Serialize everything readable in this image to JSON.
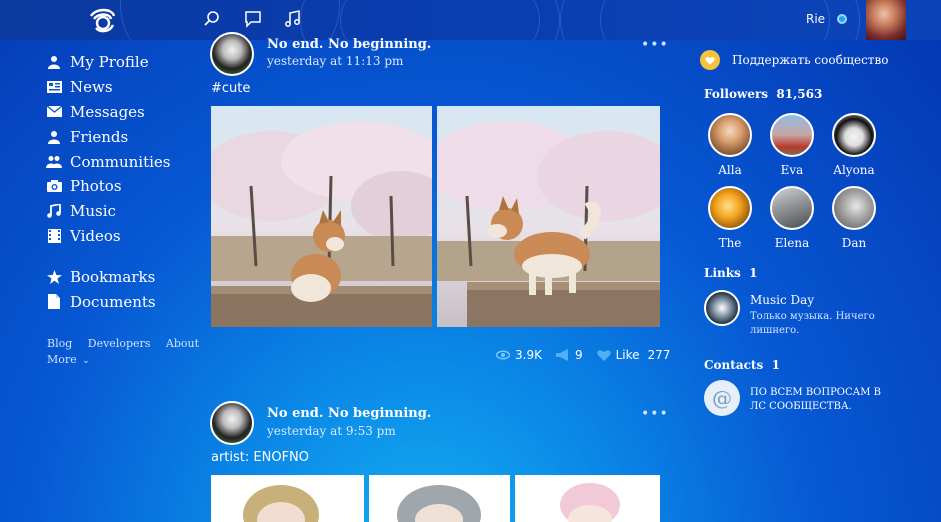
{
  "header": {
    "user_name": "Rie",
    "icons": [
      "logo-icon",
      "search-icon",
      "messages-icon",
      "music-icon"
    ]
  },
  "nav": {
    "items": [
      {
        "label": "My Profile",
        "icon": "user-icon"
      },
      {
        "label": "News",
        "icon": "news-icon"
      },
      {
        "label": "Messages",
        "icon": "mail-icon"
      },
      {
        "label": "Friends",
        "icon": "friends-icon"
      },
      {
        "label": "Communities",
        "icon": "communities-icon"
      },
      {
        "label": "Photos",
        "icon": "camera-icon"
      },
      {
        "label": "Music",
        "icon": "note-icon"
      },
      {
        "label": "Videos",
        "icon": "film-icon"
      }
    ],
    "extra": [
      {
        "label": "Bookmarks",
        "icon": "star-icon"
      },
      {
        "label": "Documents",
        "icon": "document-icon"
      }
    ],
    "footer": {
      "blog": "Blog",
      "developers": "Developers",
      "about": "About",
      "more": "More"
    }
  },
  "posts": [
    {
      "title": "No end. No beginning.",
      "time": "yesterday at 11:13 pm",
      "text": "#cute",
      "views": "3.9K",
      "reposts": "9",
      "like_label": "Like",
      "likes": "277"
    },
    {
      "title": "No end. No beginning.",
      "time": "yesterday at 9:53 pm",
      "text": "artist: ENOFNO"
    }
  ],
  "sidebar": {
    "support_label": "Поддержать сообщество",
    "followers_label": "Followers",
    "followers_count": "81,563",
    "followers": [
      {
        "name": "Alla"
      },
      {
        "name": "Eva"
      },
      {
        "name": "Alyona"
      },
      {
        "name": "The"
      },
      {
        "name": "Elena"
      },
      {
        "name": "Dan"
      }
    ],
    "links_label": "Links",
    "links_count": "1",
    "link": {
      "title": "Music Day",
      "desc": "Только музыка. Ничего лишнего."
    },
    "contacts_label": "Contacts",
    "contacts_count": "1",
    "contact": {
      "text": "ПО ВСЕМ ВОПРОСАМ В ЛС СООБЩЕСТВА."
    }
  },
  "colors": {
    "accent": "#0758d3",
    "topbar": "#0b3aa0",
    "coin": "#f6c23a"
  }
}
